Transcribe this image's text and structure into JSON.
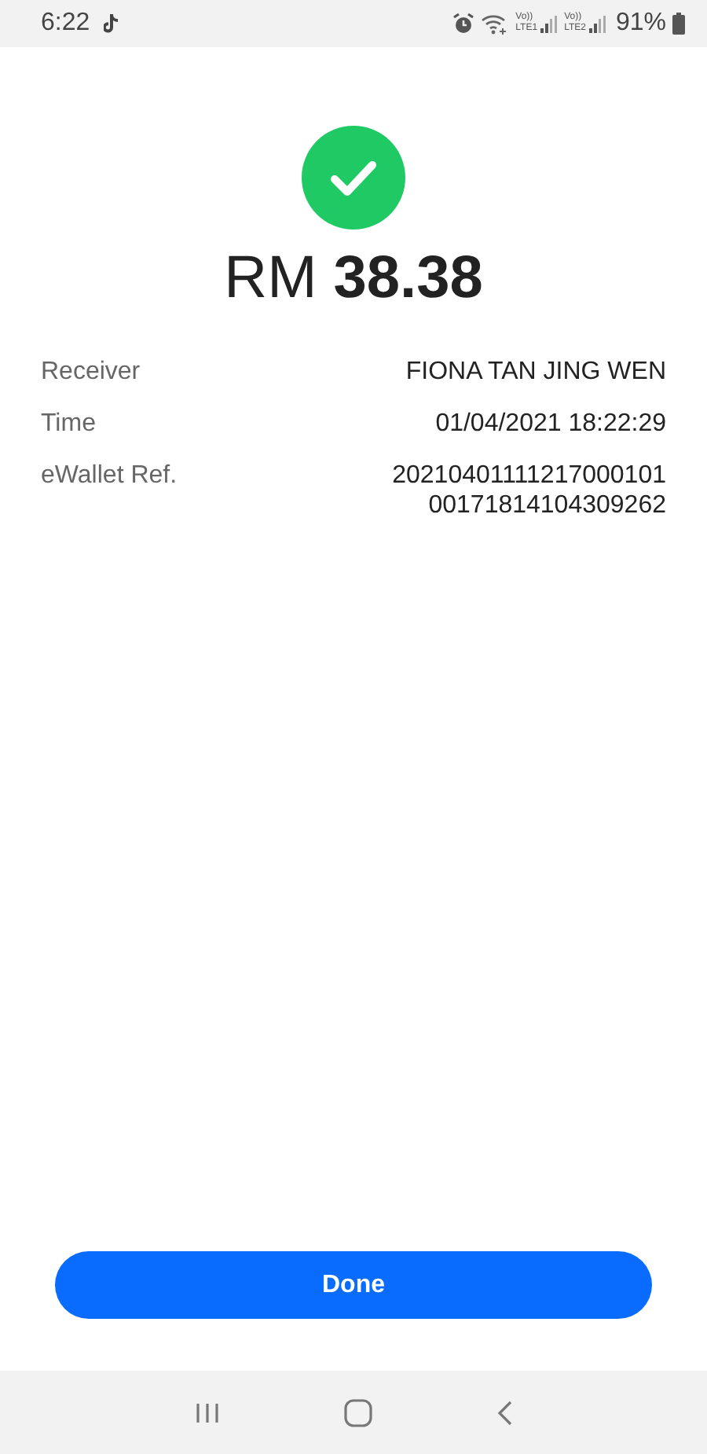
{
  "status_bar": {
    "time": "6:22",
    "sim_labels": [
      {
        "top": "Vo))",
        "bottom": "LTE1"
      },
      {
        "top": "Vo))",
        "bottom": "LTE2"
      }
    ],
    "battery": "91%"
  },
  "success": true,
  "amount": {
    "currency": "RM",
    "value": "38.38"
  },
  "details": [
    {
      "label": "Receiver",
      "value": "FIONA TAN JING WEN"
    },
    {
      "label": "Time",
      "value": "01/04/2021 18:22:29"
    },
    {
      "label": "eWallet Ref.",
      "value": "20210401111217000101\n00171814104309262"
    }
  ],
  "button": "Done"
}
